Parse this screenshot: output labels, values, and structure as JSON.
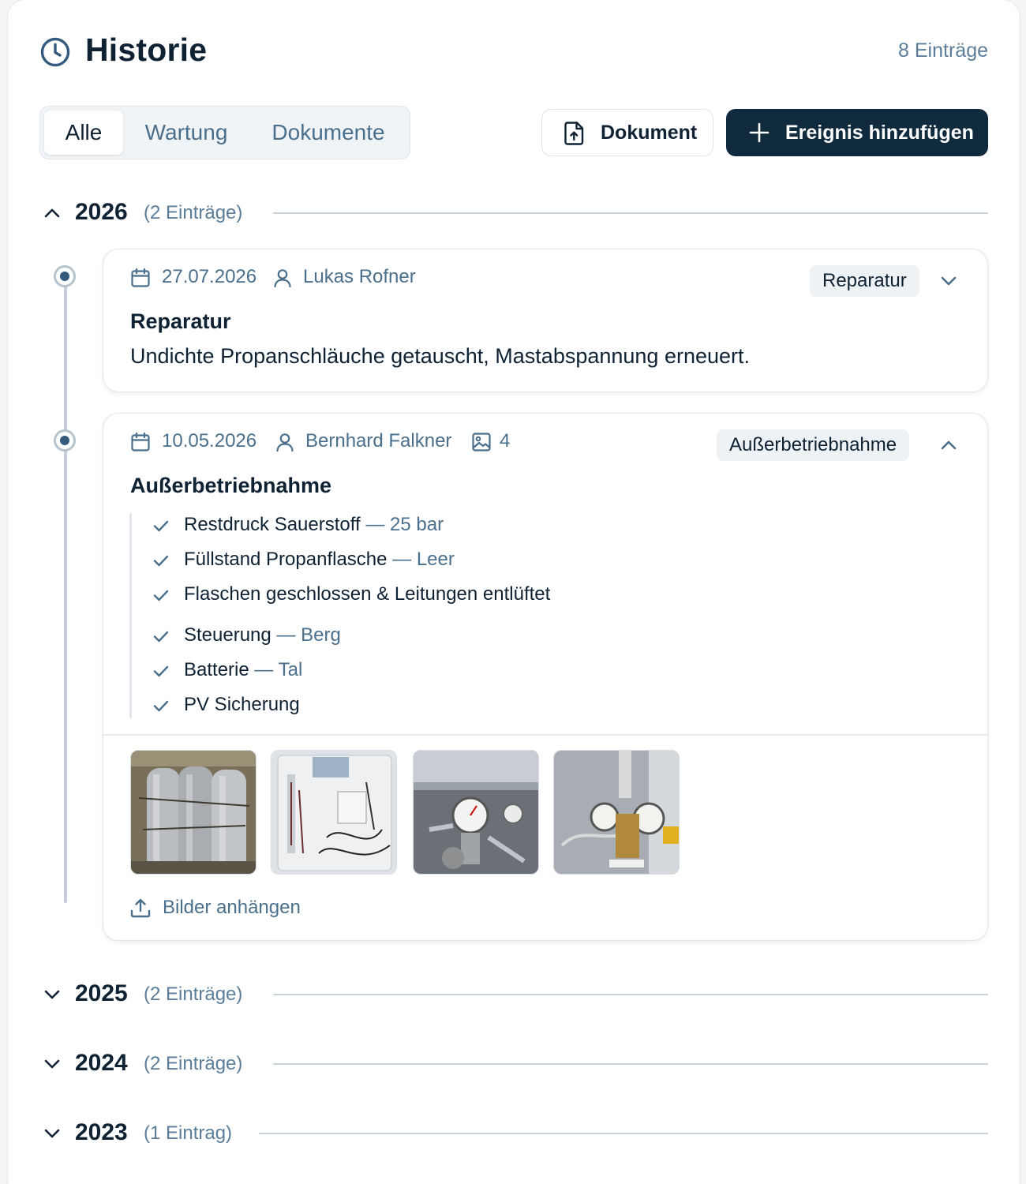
{
  "header": {
    "title": "Historie",
    "icon": "clock-icon",
    "entry_count": "8 Einträge"
  },
  "tabs": [
    {
      "label": "Alle",
      "active": true
    },
    {
      "label": "Wartung",
      "active": false
    },
    {
      "label": "Dokumente",
      "active": false
    }
  ],
  "toolbar": {
    "document_label": "Dokument",
    "add_event_label": "Ereignis hinzufügen"
  },
  "years": [
    {
      "year": "2026",
      "count": "(2 Einträge)",
      "expanded": true
    },
    {
      "year": "2025",
      "count": "(2 Einträge)",
      "expanded": false
    },
    {
      "year": "2024",
      "count": "(2 Einträge)",
      "expanded": false
    },
    {
      "year": "2023",
      "count": "(1 Eintrag)",
      "expanded": false
    }
  ],
  "entries": [
    {
      "date": "27.07.2026",
      "person": "Lukas Rofner",
      "badge": "Reparatur",
      "title": "Reparatur",
      "description": "Undichte Propanschläuche getauscht, Mastabspannung erneuert.",
      "expanded": false
    },
    {
      "date": "10.05.2026",
      "person": "Bernhard Falkner",
      "image_count": "4",
      "badge": "Außerbetriebnahme",
      "title": "Außerbetriebnahme",
      "expanded": true,
      "checklist": [
        {
          "label": "Restdruck Sauerstoff",
          "sep": " — ",
          "value": "25 bar"
        },
        {
          "label": "Füllstand Propanflasche",
          "sep": " — ",
          "value": "Leer"
        },
        {
          "label": "Flaschen geschlossen & Leitungen entlüftet",
          "sep": "",
          "value": ""
        },
        {
          "label": "Steuerung",
          "sep": " — ",
          "value": "Berg"
        },
        {
          "label": "Batterie",
          "sep": " — ",
          "value": "Tal"
        },
        {
          "label": "PV Sicherung",
          "sep": "",
          "value": ""
        }
      ],
      "upload_label": "Bilder anhängen"
    }
  ],
  "colors": {
    "primary": "#102a3e",
    "muted": "#4a6f8c",
    "accent_dot": "#345b7d"
  }
}
